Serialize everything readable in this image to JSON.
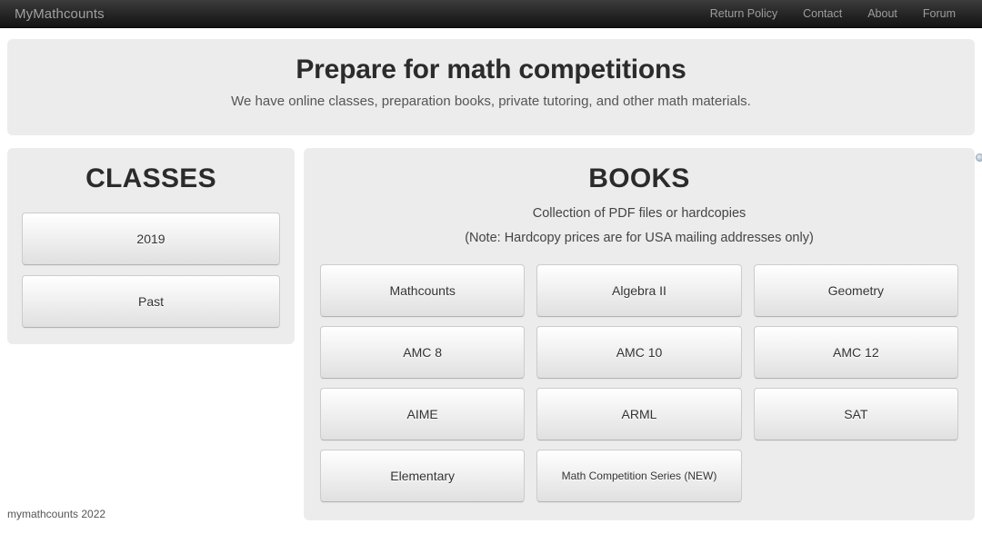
{
  "navbar": {
    "brand": "MyMathcounts",
    "links": [
      {
        "label": "Return Policy"
      },
      {
        "label": "Contact"
      },
      {
        "label": "About"
      },
      {
        "label": "Forum"
      }
    ]
  },
  "hero": {
    "title": "Prepare for math competitions",
    "subtitle": "We have online classes, preparation books, private tutoring, and other math materials."
  },
  "classes": {
    "heading": "CLASSES",
    "buttons": [
      {
        "label": "2019"
      },
      {
        "label": "Past"
      }
    ]
  },
  "books": {
    "heading": "BOOKS",
    "note1": "Collection of PDF files or hardcopies",
    "note2": "(Note: Hardcopy prices are for USA mailing addresses only)",
    "corner_icon": "copyright-marker-icon",
    "buttons": [
      {
        "label": "Mathcounts",
        "small": false
      },
      {
        "label": "Algebra II",
        "small": false
      },
      {
        "label": "Geometry",
        "small": false
      },
      {
        "label": "AMC 8",
        "small": false
      },
      {
        "label": "AMC 10",
        "small": false
      },
      {
        "label": "AMC 12",
        "small": false
      },
      {
        "label": "AIME",
        "small": false
      },
      {
        "label": "ARML",
        "small": false
      },
      {
        "label": "SAT",
        "small": false
      },
      {
        "label": "Elementary",
        "small": false
      },
      {
        "label": "Math Competition Series (NEW)",
        "small": true
      }
    ]
  },
  "footer": {
    "text": "mymathcounts 2022"
  },
  "colors": {
    "navbar_bg": "#1b1b1b",
    "navbar_text": "#9d9d9d",
    "panel_bg": "#ececec",
    "heading_text": "#2b2b2b",
    "body_text": "#333333",
    "page_bg": "#ffffff"
  }
}
